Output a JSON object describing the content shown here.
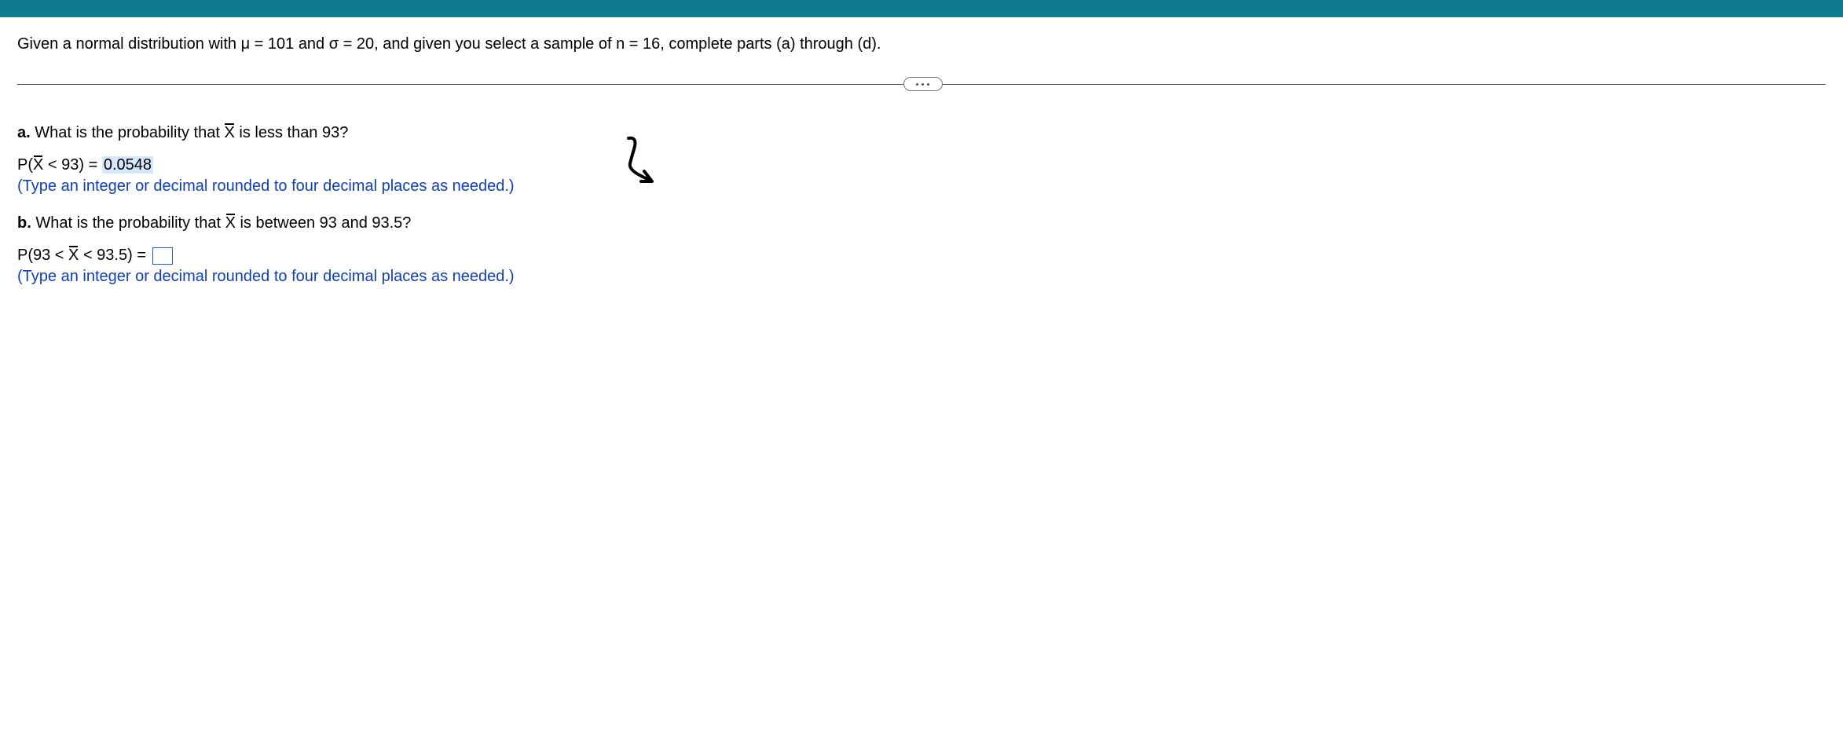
{
  "prompt": "Given a normal distribution with μ = 101 and σ = 20, and given you select a sample of n = 16, complete parts (a) through (d).",
  "partA": {
    "label": "a.",
    "question_pre": " What is the probability that ",
    "question_var": "X",
    "question_post": " is less than 93?",
    "answer_pre": "P(",
    "answer_var": "X",
    "answer_mid": " < 93) = ",
    "answer_val": "0.0548",
    "hint": "(Type an integer or decimal rounded to four decimal places as needed.)"
  },
  "partB": {
    "label": "b.",
    "question_pre": " What is the probability that ",
    "question_var": "X",
    "question_post": " is between 93 and 93.5?",
    "answer_pre": "P(93 < ",
    "answer_var": "X",
    "answer_mid": " < 93.5) = ",
    "hint": "(Type an integer or decimal rounded to four decimal places as needed.)"
  }
}
